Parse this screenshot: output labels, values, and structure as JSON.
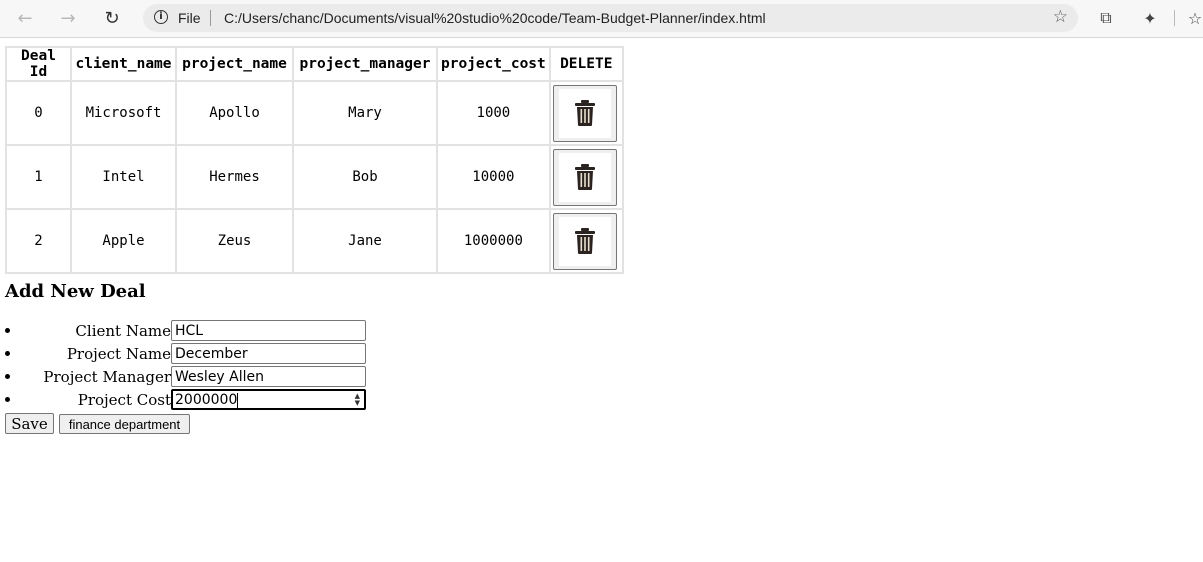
{
  "browser": {
    "back_icon": "arrow-left-icon",
    "forward_icon": "arrow-right-icon",
    "reload_icon": "reload-icon",
    "scheme": "File",
    "url": "C:/Users/chanc/Documents/visual%20studio%20code/Team-Budget-Planner/index.html"
  },
  "table": {
    "headers": [
      "Deal Id",
      "client_name",
      "project_name",
      "project_manager",
      "project_cost",
      "DELETE"
    ],
    "rows": [
      {
        "id": "0",
        "client": "Microsoft",
        "project": "Apollo",
        "manager": "Mary",
        "cost": "1000"
      },
      {
        "id": "1",
        "client": "Intel",
        "project": "Hermes",
        "manager": "Bob",
        "cost": "10000"
      },
      {
        "id": "2",
        "client": "Apple",
        "project": "Zeus",
        "manager": "Jane",
        "cost": "1000000"
      }
    ],
    "delete_icon": "trash-icon"
  },
  "form": {
    "title": "Add New Deal",
    "fields": [
      {
        "label": "Client Name",
        "value": "HCL"
      },
      {
        "label": "Project Name",
        "value": "December"
      },
      {
        "label": "Project Manager",
        "value": "Wesley Allen"
      },
      {
        "label": "Project Cost",
        "value": "2000000"
      }
    ],
    "save_label": "Save",
    "finance_label": "finance department"
  }
}
